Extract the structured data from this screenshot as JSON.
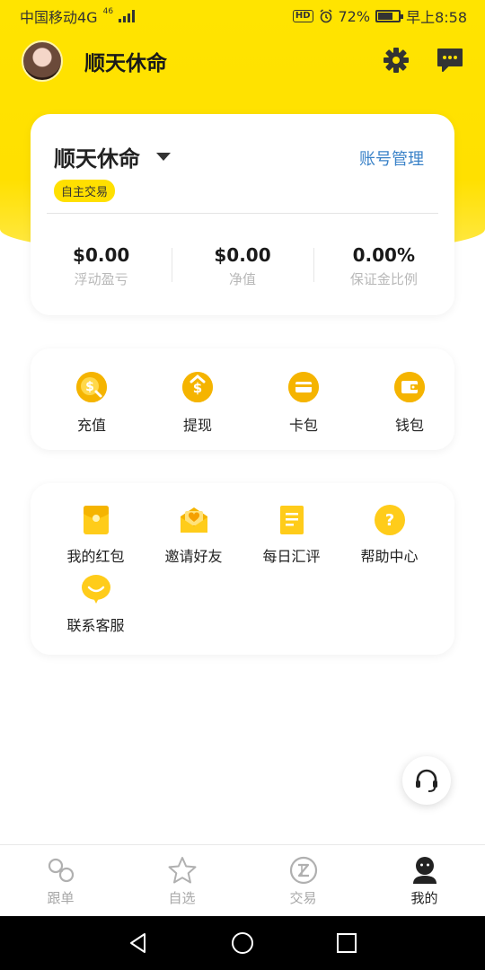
{
  "status_bar": {
    "carrier": "中国移动4G",
    "network_badge": "46",
    "battery": "72%",
    "battery_level": 0.72,
    "time": "早上8:58",
    "hd": "HD"
  },
  "header": {
    "username": "顺天休命",
    "settings_icon": "gear-icon",
    "message_icon": "chat-icon"
  },
  "account_card": {
    "account_name": "顺天休命",
    "manage_label": "账号管理",
    "tag": "自主交易",
    "stats": [
      {
        "value": "$0.00",
        "label": "浮动盈亏"
      },
      {
        "value": "$0.00",
        "label": "净值"
      },
      {
        "value": "0.00%",
        "label": "保证金比例"
      }
    ]
  },
  "funds": [
    {
      "label": "充值",
      "icon": "deposit-coin-icon",
      "glyph": "$"
    },
    {
      "label": "提现",
      "icon": "withdraw-coin-icon",
      "glyph": "$"
    },
    {
      "label": "卡包",
      "icon": "card-icon",
      "glyph": ""
    },
    {
      "label": "钱包",
      "icon": "wallet-icon",
      "glyph": ""
    }
  ],
  "services": [
    {
      "label": "我的红包",
      "icon": "red-packet-icon"
    },
    {
      "label": "邀请好友",
      "icon": "invite-envelope-icon"
    },
    {
      "label": "每日汇评",
      "icon": "daily-review-doc-icon"
    },
    {
      "label": "帮助中心",
      "icon": "help-icon"
    },
    {
      "label": "联系客服",
      "icon": "customer-service-bubble-icon"
    }
  ],
  "floating_button": {
    "icon": "headset-icon"
  },
  "tabbar": [
    {
      "label": "跟单",
      "icon": "link-icon",
      "active": false
    },
    {
      "label": "自选",
      "icon": "star-icon",
      "active": false
    },
    {
      "label": "交易",
      "icon": "trade-z-icon",
      "active": false
    },
    {
      "label": "我的",
      "icon": "user-icon",
      "active": true
    }
  ],
  "colors": {
    "brand_yellow": "#ffe000",
    "link_blue": "#3a82c8",
    "icon_gold": "#f5b400"
  }
}
